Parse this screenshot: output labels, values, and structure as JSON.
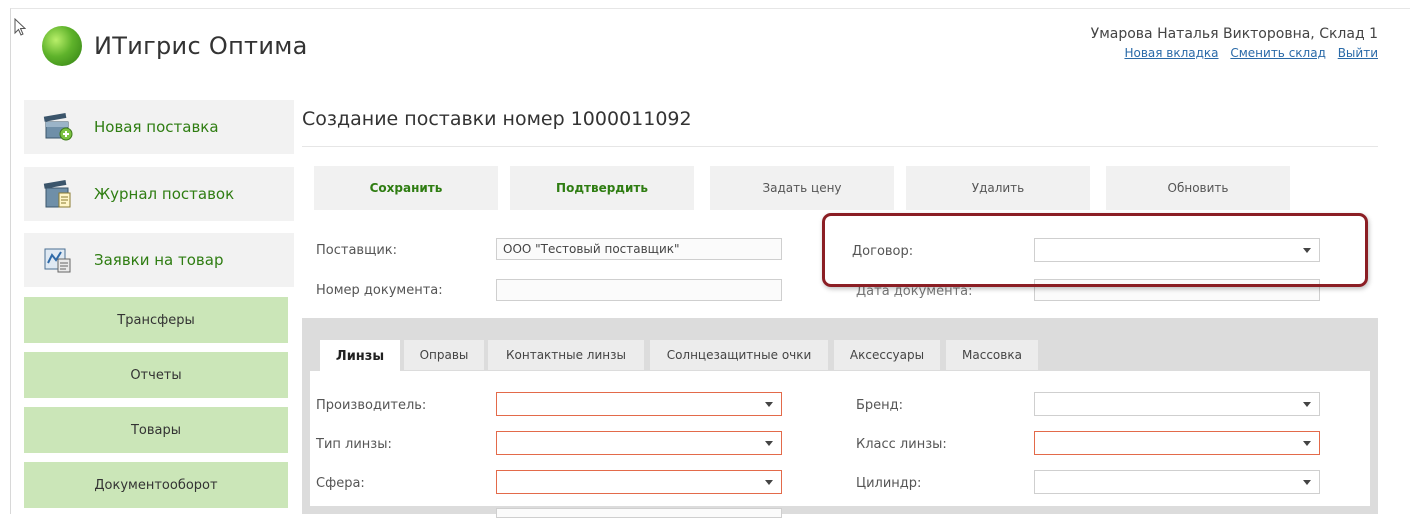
{
  "header": {
    "app_title": "ИТигрис Оптима",
    "user": "Умарова Наталья Викторовна, Склад 1",
    "links": [
      "Новая вкладка",
      "Сменить склад",
      "Выйти"
    ]
  },
  "sidebar": {
    "big_items": [
      {
        "label": "Новая поставка",
        "icon": "box-delivery-icon"
      },
      {
        "label": "Журнал поставок",
        "icon": "journal-icon"
      },
      {
        "label": "Заявки на товар",
        "icon": "request-chart-icon"
      }
    ],
    "green_items": [
      "Трансферы",
      "Отчеты",
      "Товары",
      "Документооборот"
    ]
  },
  "main": {
    "title": "Создание поставки номер 1000011092",
    "toolbar": [
      "Сохранить",
      "Подтвердить",
      "Задать цену",
      "Удалить",
      "Обновить"
    ],
    "form": {
      "supplier_label": "Поставщик:",
      "supplier_value": "ООО \"Тестовый поставщик\"",
      "docnum_label": "Номер документа:",
      "docnum_value": "",
      "contract_label": "Договор:",
      "contract_value": "",
      "docdate_label": "Дата документа:",
      "docdate_value": ""
    },
    "tabs": [
      "Линзы",
      "Оправы",
      "Контактные линзы",
      "Солнцезащитные очки",
      "Аксессуары",
      "Массовка"
    ],
    "active_tab": "Линзы",
    "lens_fields": {
      "manufacturer": "Производитель:",
      "lens_type": "Тип линзы:",
      "sphere": "Сфера:",
      "brand": "Бренд:",
      "lens_class": "Класс линзы:",
      "cylinder": "Цилиндр:"
    }
  },
  "colors": {
    "accent_green": "#2f7d12",
    "highlight": "#8b1e24",
    "required_border": "#e36a4a"
  }
}
